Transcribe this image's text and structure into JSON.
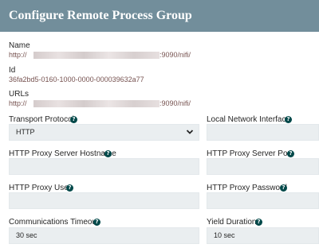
{
  "dialog": {
    "title": "Configure Remote Process Group"
  },
  "name": {
    "label": "Name",
    "value_prefix": "http://",
    "value_suffix": ":9090/nifi/"
  },
  "id": {
    "label": "Id",
    "value": "36fa2bd5-0160-1000-0000-000039632a77"
  },
  "urls": {
    "label": "URLs",
    "value_prefix": "http://",
    "value_suffix": ":9090/nifi/"
  },
  "transport_protocol": {
    "label": "Transport Protocol",
    "value": "HTTP"
  },
  "local_network_interface": {
    "label": "Local Network Interface",
    "value": ""
  },
  "http_proxy_server_hostname": {
    "label": "HTTP Proxy Server Hostname",
    "value": ""
  },
  "http_proxy_server_port": {
    "label": "HTTP Proxy Server Port",
    "value": ""
  },
  "http_proxy_user": {
    "label": "HTTP Proxy User",
    "value": ""
  },
  "http_proxy_password": {
    "label": "HTTP Proxy Password",
    "value": ""
  },
  "communications_timeout": {
    "label": "Communications Timeout",
    "value": "30 sec"
  },
  "yield_duration": {
    "label": "Yield Duration",
    "value": "10 sec"
  },
  "icons": {
    "help": "question-circle-icon",
    "dropdown": "chevron-down-icon"
  },
  "colors": {
    "header": "#728e9b",
    "help_icon": "#004849",
    "value_text": "#775351",
    "field_bg": "#eaeef0"
  }
}
